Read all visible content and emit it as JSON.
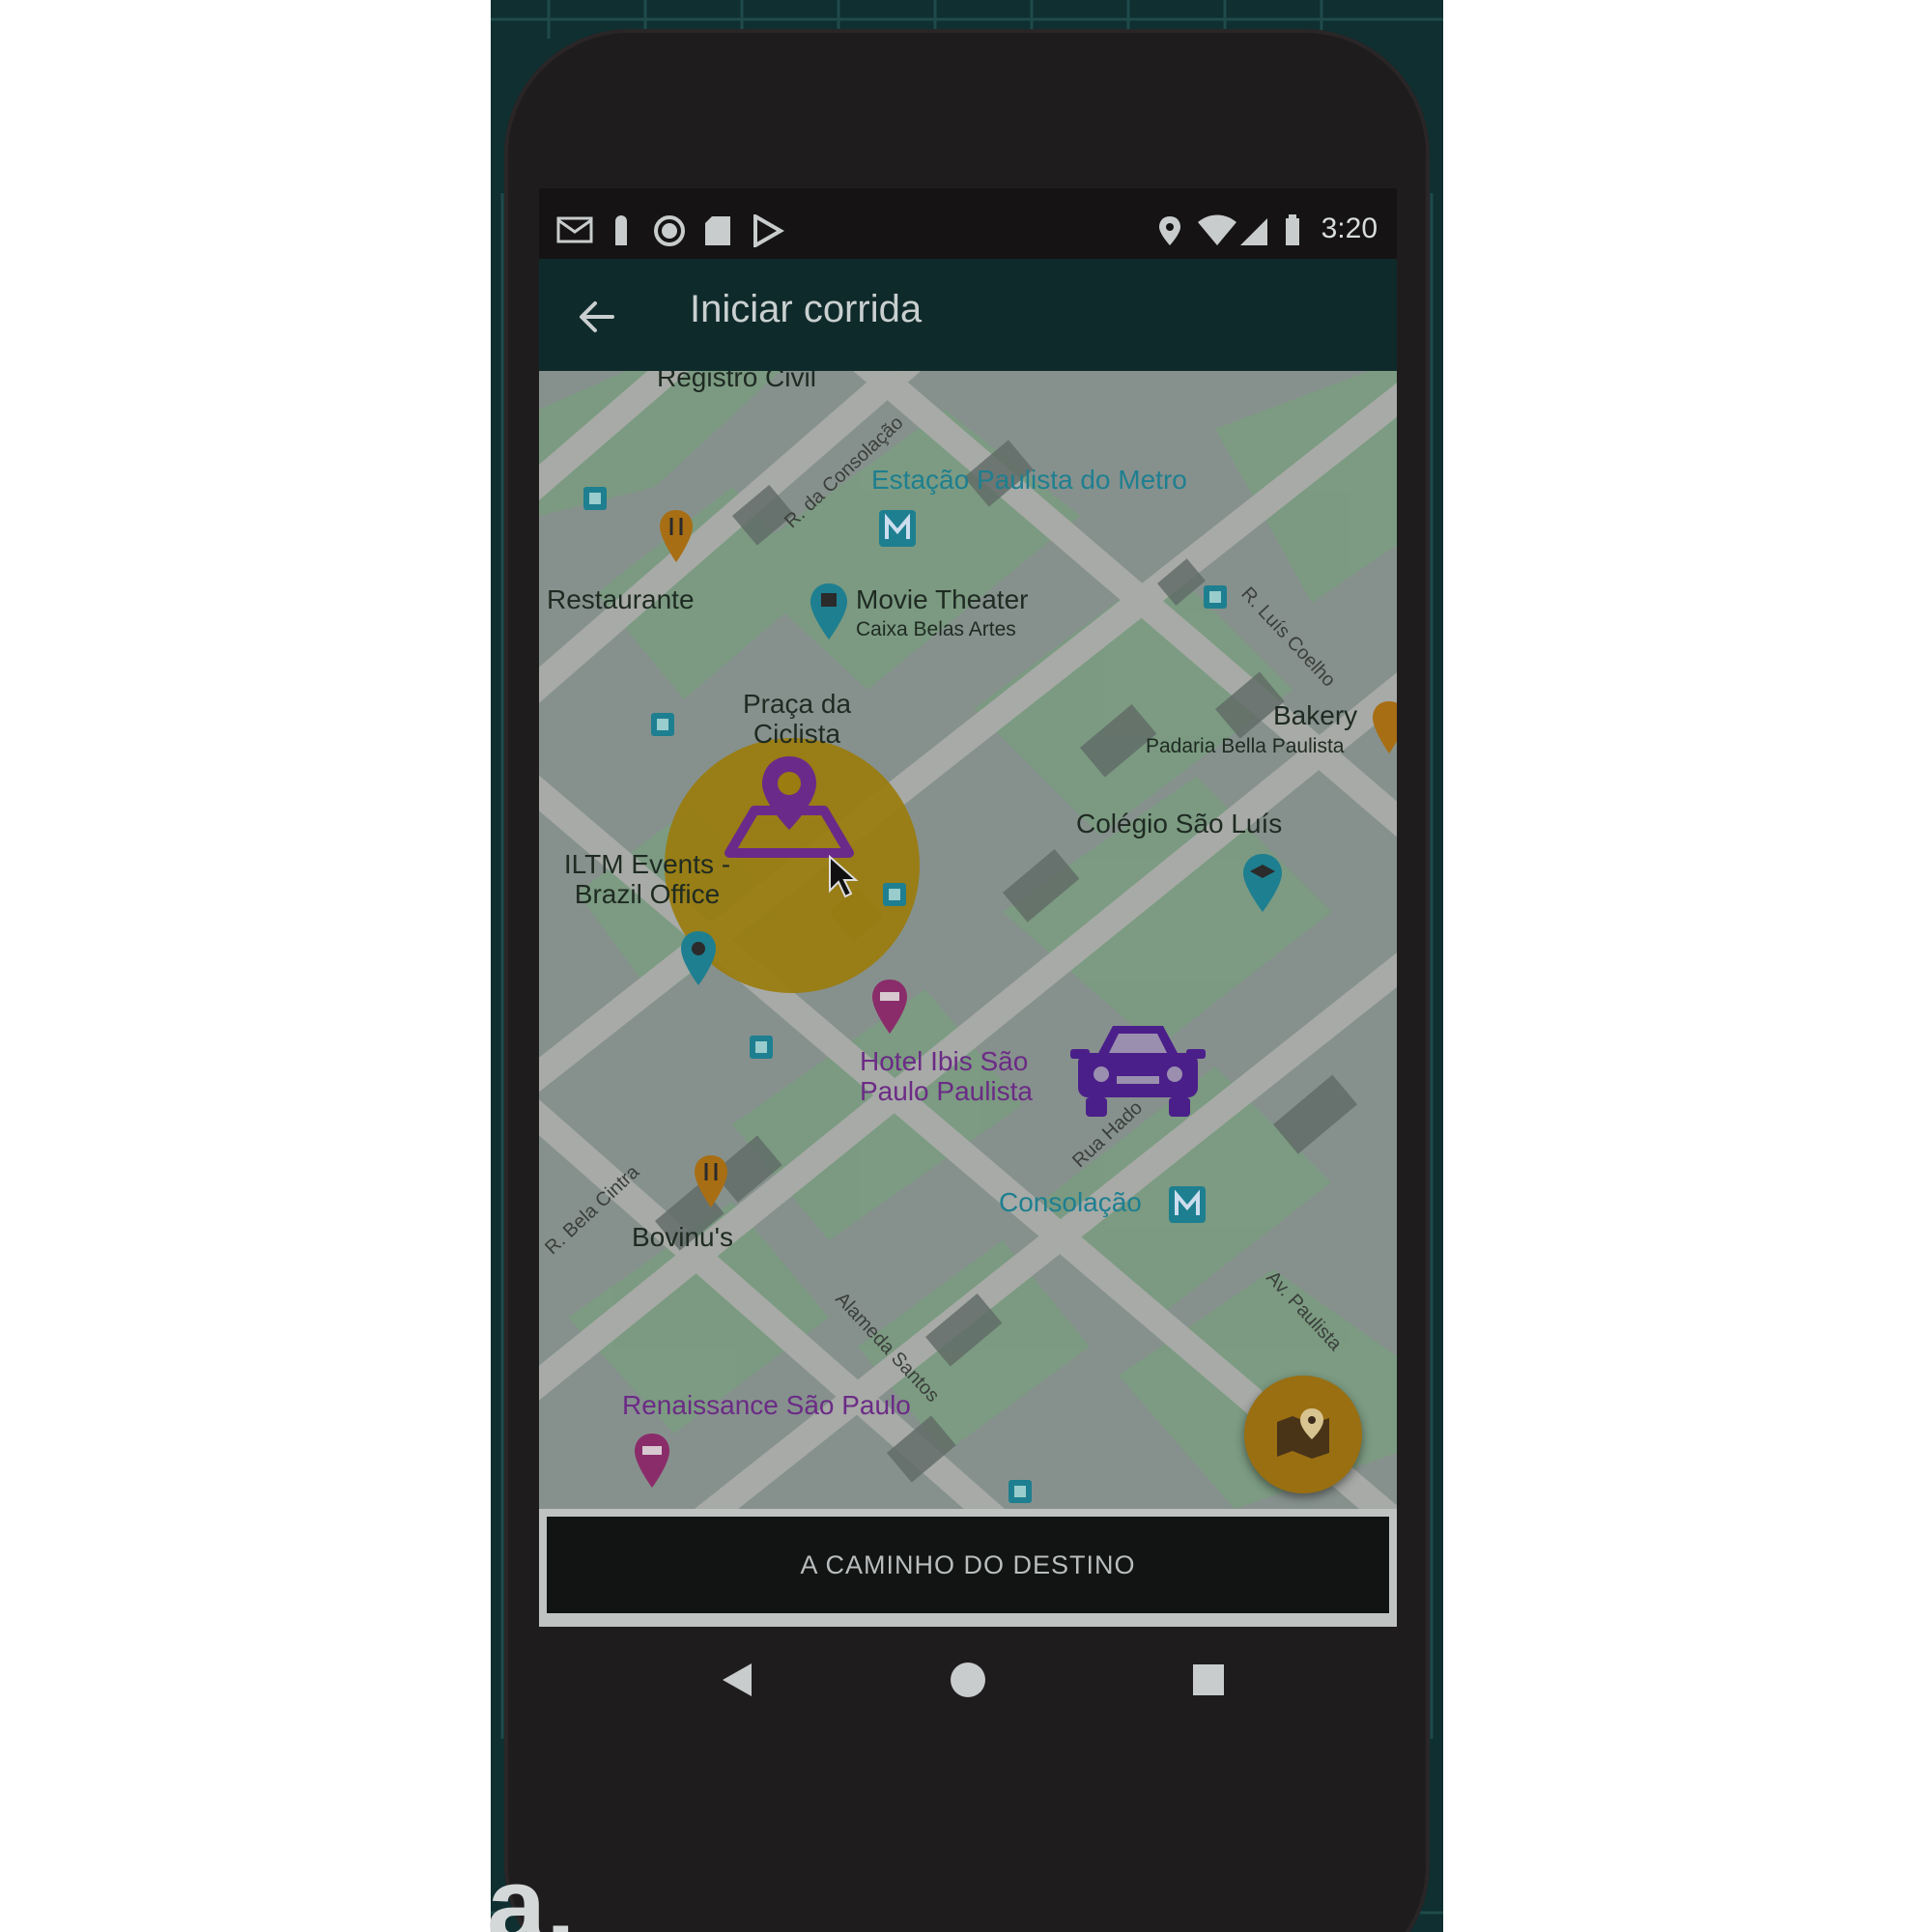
{
  "status_bar": {
    "time": "3:20",
    "left_icons": [
      "gmail-icon",
      "notification-icon",
      "record-icon",
      "sd-card-icon",
      "play-store-icon"
    ],
    "right_icons": [
      "location-icon",
      "wifi-icon",
      "signal-icon",
      "battery-icon"
    ]
  },
  "app_bar": {
    "title": "Iniciar corrida",
    "back_icon": "arrow-back-icon"
  },
  "map": {
    "places": {
      "registro_civil": "Registro Civil",
      "estacao_paulista": "Estação Paulista do Metro",
      "restaurante": "Restaurante",
      "movie_theater": "Movie Theater",
      "caixa_belas_artes": "Caixa Belas Artes",
      "praca_ciclista": "Praça da Ciclista",
      "bakery": "Bakery",
      "padaria": "Padaria Bella Paulista",
      "colegio": "Colégio São Luís",
      "iltm": "ILTM Events - Brazil Office",
      "hotel_ibis": "Hotel Ibis São Paulo Paulista",
      "consolacao": "Consolação",
      "bovinus": "Bovinu's",
      "renaissance": "Renaissance São Paulo"
    },
    "streets": {
      "consolacao": "R. da Consolação",
      "luis_coelho": "R. Luís Coelho",
      "bela_cintra": "R. Bela Cintra",
      "alameda_santos": "Alameda Santos",
      "av_paulista": "Av. Paulista",
      "rua_haddock": "Rua Hado"
    },
    "destination_marker_icon": "map-pin-destination-icon",
    "vehicle_icon": "car-icon",
    "fab_icon": "map-location-icon",
    "colors": {
      "destination_circle": "#9a7c10",
      "marker_purple": "#6a2a8a",
      "poi_blue": "#1e7f90",
      "food_orange": "#a86e14"
    }
  },
  "bottom": {
    "status_button_label": "A CAMINHO DO DESTINO"
  },
  "nav_bar": {
    "back": "nav-back-icon",
    "home": "nav-home-icon",
    "recents": "nav-recents-icon"
  },
  "background": {
    "partial_text": "a."
  }
}
